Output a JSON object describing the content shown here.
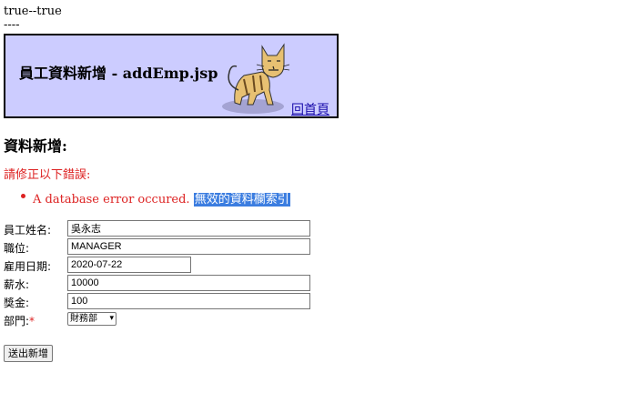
{
  "top": {
    "line1": "true--true",
    "line2": "----"
  },
  "header": {
    "title": "員工資料新增 - addEmp.jsp",
    "home_link": "回首頁",
    "background_color": "#CCCCFF"
  },
  "section_title": "資料新增:",
  "errors": {
    "heading": "請修正以下錯誤:",
    "items": [
      {
        "text": "A database error occured. ",
        "selected_text": "無效的資料欄索引"
      }
    ],
    "color": "#dd2222"
  },
  "form": {
    "ename": {
      "label": "員工姓名:",
      "value": "吳永志"
    },
    "job": {
      "label": "職位:",
      "value": "MANAGER"
    },
    "hiredate": {
      "label": "雇用日期:",
      "value": "2020-07-22"
    },
    "sal": {
      "label": "薪水:",
      "value": "10000"
    },
    "comm": {
      "label": "獎金:",
      "value": "100"
    },
    "deptno": {
      "label": "部門:",
      "required_mark": "*",
      "selected": "財務部"
    },
    "submit_label": "送出新增"
  },
  "icons": {
    "logo": "tomcat-logo"
  }
}
